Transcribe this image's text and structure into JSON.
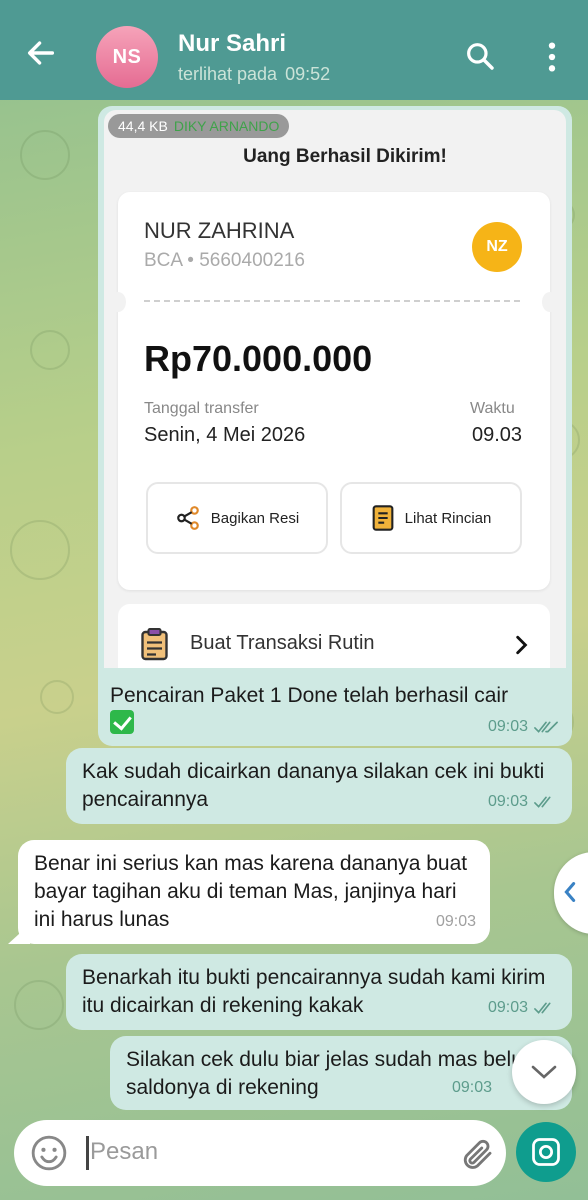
{
  "header": {
    "avatar_initials": "NS",
    "contact_name": "Nur Sahri",
    "last_seen_label": "terlihat pada",
    "last_seen_time": "09:52"
  },
  "image_message": {
    "file_size": "44,4 KB",
    "sender_name": "DIKY ARNANDO",
    "receipt": {
      "title": "Uang Berhasil Dikirim!",
      "recipient_name": "NUR ZAHRINA",
      "recipient_bank": "BCA • 5660400216",
      "recipient_initials": "NZ",
      "amount": "Rp70.000.000",
      "date_label": "Tanggal transfer",
      "date_value": "Senin, 4 Mei 2026",
      "time_label": "Waktu",
      "time_value": "09.03",
      "share_label": "Bagikan Resi",
      "detail_label": "Lihat Rincian",
      "routine_label": "Buat Transaksi Rutin"
    },
    "caption": "Pencairan Paket 1 Done telah berhasil cair",
    "time": "09:03"
  },
  "messages": [
    {
      "direction": "out",
      "text": "Kak sudah dicairkan dananya silakan cek ini bukti pencairannya",
      "time": "09:03"
    },
    {
      "direction": "in",
      "text": "Benar ini serius kan mas karena dananya buat bayar tagihan aku di teman Mas, janjinya hari ini harus lunas",
      "time": "09:03"
    },
    {
      "direction": "out",
      "text": "Benarkah itu bukti pencairannya sudah kami kirim itu dicairkan di rekening kakak",
      "time": "09:03"
    },
    {
      "direction": "out",
      "text": "Silakan cek dulu biar jelas sudah mas belum saldonya di rekening",
      "time": "09:03"
    }
  ],
  "input": {
    "placeholder": "Pesan"
  },
  "colors": {
    "header": "#4f9a93",
    "outgoing_bubble": "#cfe9e3",
    "incoming_bubble": "#ffffff",
    "camera_button": "#0f9d8e",
    "avatar": "#e56c93",
    "recipient_badge": "#f6b417"
  }
}
